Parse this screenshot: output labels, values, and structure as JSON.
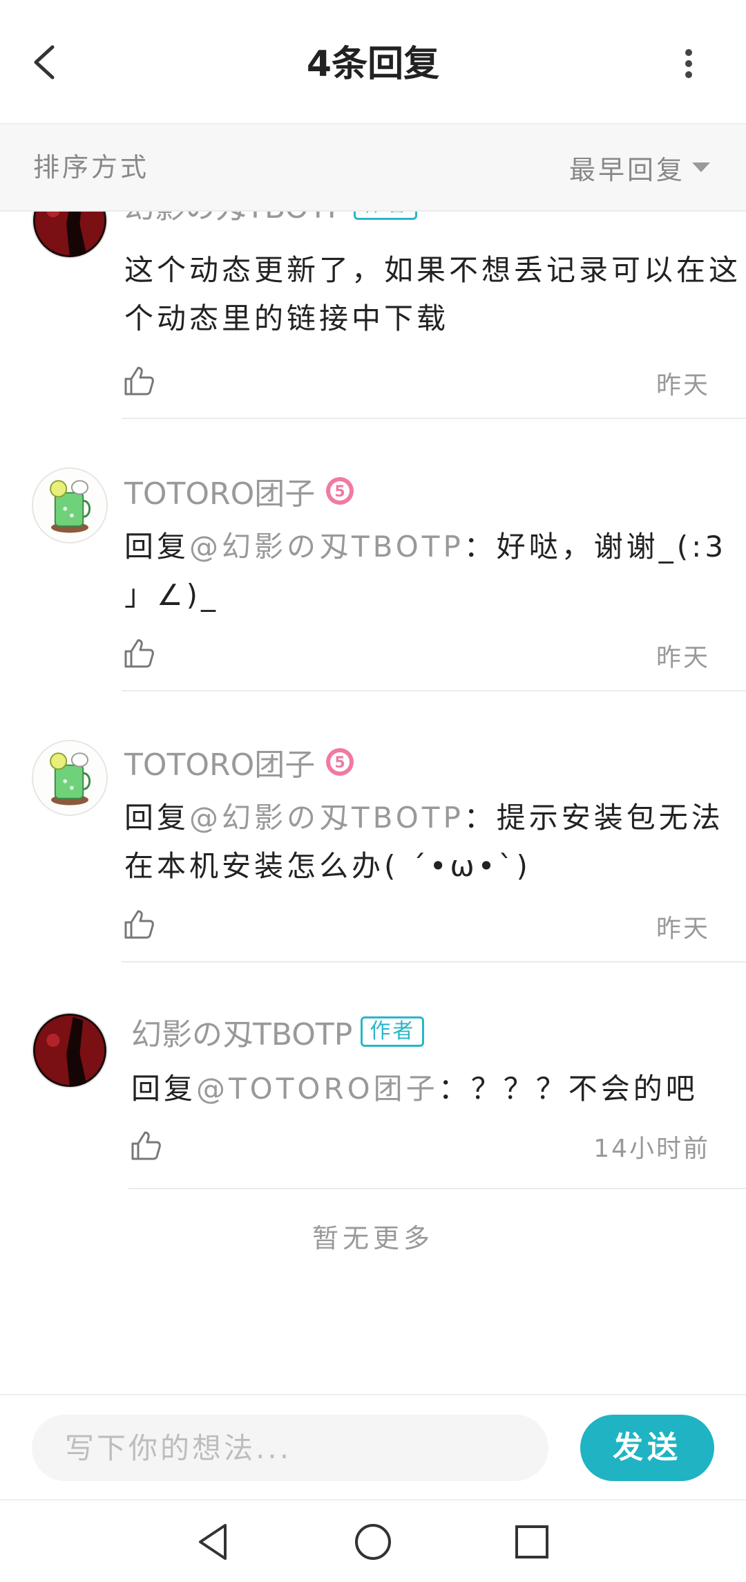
{
  "header": {
    "title": "4条回复"
  },
  "sort": {
    "label": "排序方式",
    "value": "最早回复"
  },
  "replies": [
    {
      "name": "幻影の刄TBOTP",
      "badge": "作者",
      "text": "这个动态更新了，如果不想丢记录可以在这个动态里的链接中下载",
      "time": "昨天"
    },
    {
      "name": "TOTORO团子",
      "level": "5",
      "reply_prefix": "回复",
      "mention": "@幻影の刄TBOTP",
      "text": "：好哒，谢谢_(:3 」∠)_",
      "time": "昨天"
    },
    {
      "name": "TOTORO团子",
      "level": "5",
      "reply_prefix": "回复",
      "mention": "@幻影の刄TBOTP",
      "text": "：提示安装包无法在本机安装怎么办( ´•ω•`)",
      "time": "昨天"
    },
    {
      "name": "幻影の刄TBOTP",
      "badge": "作者",
      "reply_prefix": "回复",
      "mention": "@TOTORO团子",
      "text": "：？？？不会的吧",
      "time": "14小时前"
    }
  ],
  "footer": {
    "no_more": "暂无更多"
  },
  "input": {
    "placeholder": "写下你的想法...",
    "value": ""
  },
  "send": {
    "label": "发送"
  },
  "colors": {
    "accent": "#1fb3c3",
    "level_badge": "#f07aa0",
    "muted": "#999999"
  }
}
